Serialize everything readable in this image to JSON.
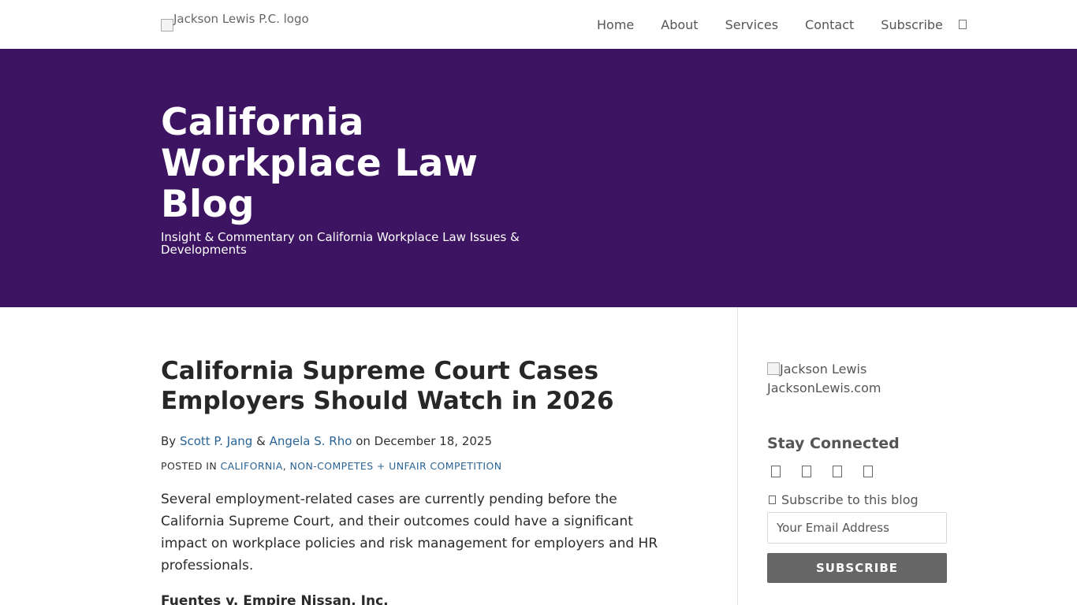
{
  "header": {
    "logo_alt": "Jackson Lewis P.C. logo",
    "nav": [
      "Home",
      "About",
      "Services",
      "Contact",
      "Subscribe"
    ],
    "search_icon": "search-icon"
  },
  "hero": {
    "title": "California Workplace Law Blog",
    "tagline": "Insight & Commentary on California Workplace Law Issues & Developments",
    "background": "#3c1461"
  },
  "post": {
    "title": "California Supreme Court Cases Employers Should Watch in 2026",
    "by_prefix": "By",
    "author1": "Scott P. Jang",
    "amp": "&",
    "author2": "Angela S. Rho",
    "date_prefix": "on",
    "date": "December 18, 2025",
    "posted_in": "POSTED IN",
    "category1": "CALIFORNIA",
    "category2": "NON-COMPETES + UNFAIR COMPETITION",
    "intro": "Several employment-related cases are currently pending before the California Supreme Court, and their outcomes could have a significant impact on workplace policies and risk management for employers and HR professionals.",
    "subhead": "Fuentes v. Empire Nissan, Inc."
  },
  "sidebar": {
    "logo_alt": "Jackson Lewis",
    "site_link": "JacksonLewis.com",
    "stay_connected": "Stay Connected",
    "social_icons": [
      "linkedin-icon",
      "twitter-icon",
      "facebook-icon",
      "rss-icon"
    ],
    "subscribe_label": "Subscribe to this blog",
    "email_placeholder": "Your Email Address",
    "subscribe_button": "SUBSCRIBE"
  },
  "colors": {
    "accent": "#3c1461",
    "link": "#2a6496",
    "button": "#666666"
  }
}
